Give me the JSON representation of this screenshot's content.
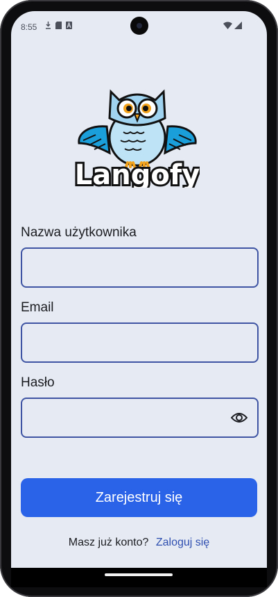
{
  "status_bar": {
    "time": "8:55"
  },
  "app": {
    "brand": "Langofy"
  },
  "form": {
    "username_label": "Nazwa użytkownika",
    "email_label": "Email",
    "password_label": "Hasło",
    "username_value": "",
    "email_value": "",
    "password_value": ""
  },
  "actions": {
    "register_label": "Zarejestruj się",
    "have_account_text": "Masz już konto?",
    "login_link": "Zaloguj się"
  },
  "colors": {
    "accent": "#2a63e8",
    "field_border": "#3f55a3",
    "background": "#e5eaf3",
    "link": "#2f4fb0"
  },
  "icons": [
    "download-icon",
    "sd-card-icon",
    "font-icon",
    "wifi-icon",
    "cell-signal-icon",
    "eye-icon"
  ]
}
